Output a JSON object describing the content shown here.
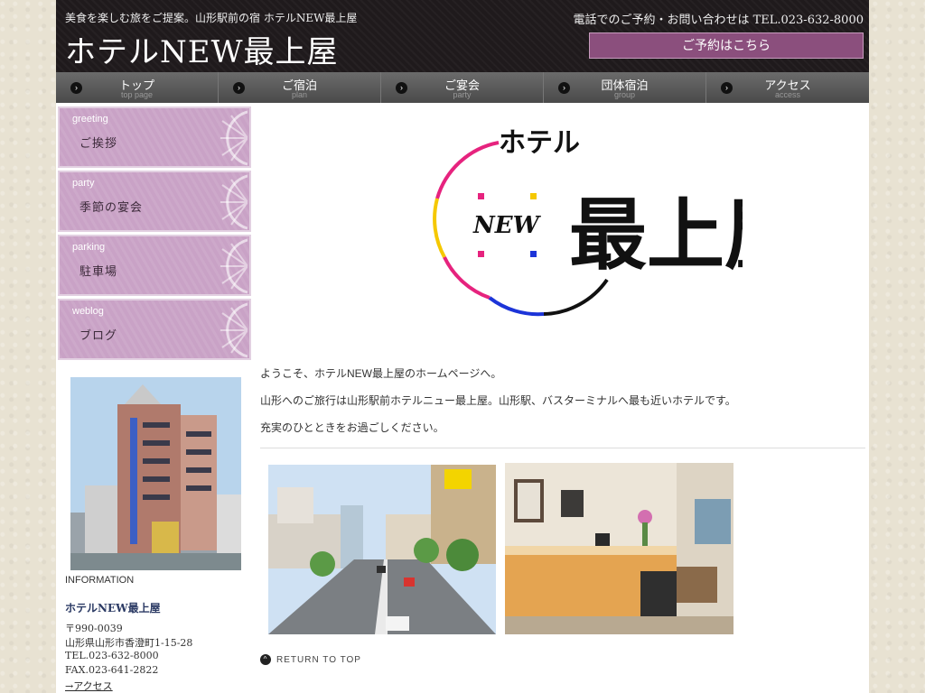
{
  "header": {
    "tagline": "美食を楽しむ旅をご提案。山形駅前の宿 ホテルNEW最上屋",
    "title": "ホテルNEW最上屋",
    "phone_text": "電話でのご予約・お問い合わせは TEL.023-632-8000",
    "reserve_label": "ご予約はこちら"
  },
  "nav": {
    "items": [
      {
        "label": "トップ",
        "sub": "top page"
      },
      {
        "label": "ご宿泊",
        "sub": "plan"
      },
      {
        "label": "ご宴会",
        "sub": "party"
      },
      {
        "label": "団体宿泊",
        "sub": "group"
      },
      {
        "label": "アクセス",
        "sub": "access"
      }
    ]
  },
  "sidebar": {
    "items": [
      {
        "en": "greeting",
        "ja": "ご挨拶"
      },
      {
        "en": "party",
        "ja": "季節の宴会"
      },
      {
        "en": "parking",
        "ja": "駐車場"
      },
      {
        "en": "weblog",
        "ja": "ブログ"
      }
    ],
    "info": {
      "label": "INFORMATION",
      "name": "ホテルNEW最上屋",
      "zip": "〒990-0039",
      "address": "山形県山形市香澄町1-15-28",
      "tel": "TEL.023-632-8000",
      "fax": "FAX.023-641-2822",
      "access_link": "→アクセス"
    }
  },
  "logo": {
    "hotel": "ホテル",
    "new": "NEW",
    "name": "最上屋"
  },
  "main": {
    "welcome_1": "ようこそ、ホテルNEW最上屋のホームページへ。",
    "welcome_2": "山形へのご旅行は山形駅前ホテルニュー最上屋。山形駅、バスターミナルへ最も近いホテルです。",
    "welcome_3": "充実のひとときをお過ごしください。",
    "return_label": "RETURN TO TOP"
  },
  "colors": {
    "header_bg": "#1f1a1c",
    "reserve_button": "#8b4f7d",
    "sidebar_item": "#c9a2c6",
    "info_name": "#2b3a64"
  }
}
